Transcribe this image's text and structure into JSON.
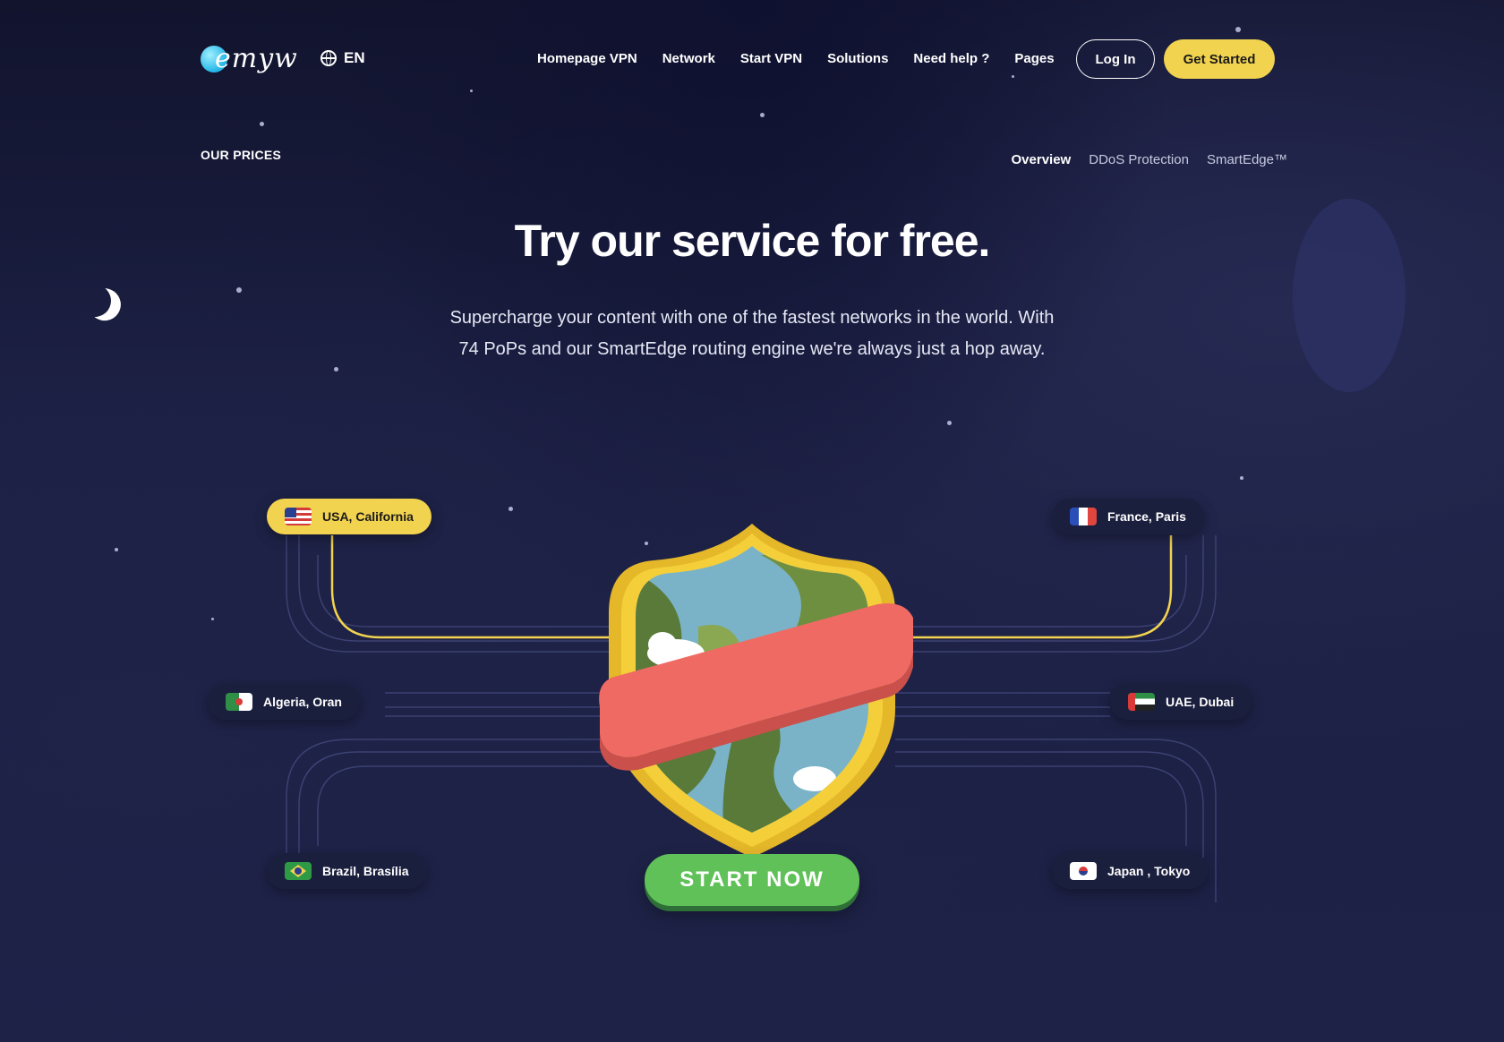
{
  "header": {
    "logo_text": "emyw",
    "language": "EN",
    "nav": [
      "Homepage VPN",
      "Network",
      "Start VPN",
      "Solutions",
      "Need help ?",
      "Pages"
    ],
    "login_label": "Log In",
    "get_started_label": "Get Started"
  },
  "section": {
    "label": "OUR PRICES",
    "tabs": [
      "Overview",
      "DDoS Protection",
      "SmartEdge™"
    ]
  },
  "hero": {
    "title": "Try our service for free.",
    "subtitle": "Supercharge your content with one of the fastest networks in the world. With 74 PoPs and our SmartEdge routing engine we're always just a hop away."
  },
  "locations": {
    "usa": "USA, California",
    "france": "France, Paris",
    "algeria": "Algeria, Oran",
    "uae": "UAE, Dubai",
    "brazil": "Brazil, Brasília",
    "japan": "Japan , Tokyo"
  },
  "cta": {
    "start_now": "START NOW"
  },
  "colors": {
    "accent_yellow": "#f2d34f",
    "cta_green": "#5fc158",
    "shield_red": "#f06a64",
    "background": "#1a1e3c"
  }
}
